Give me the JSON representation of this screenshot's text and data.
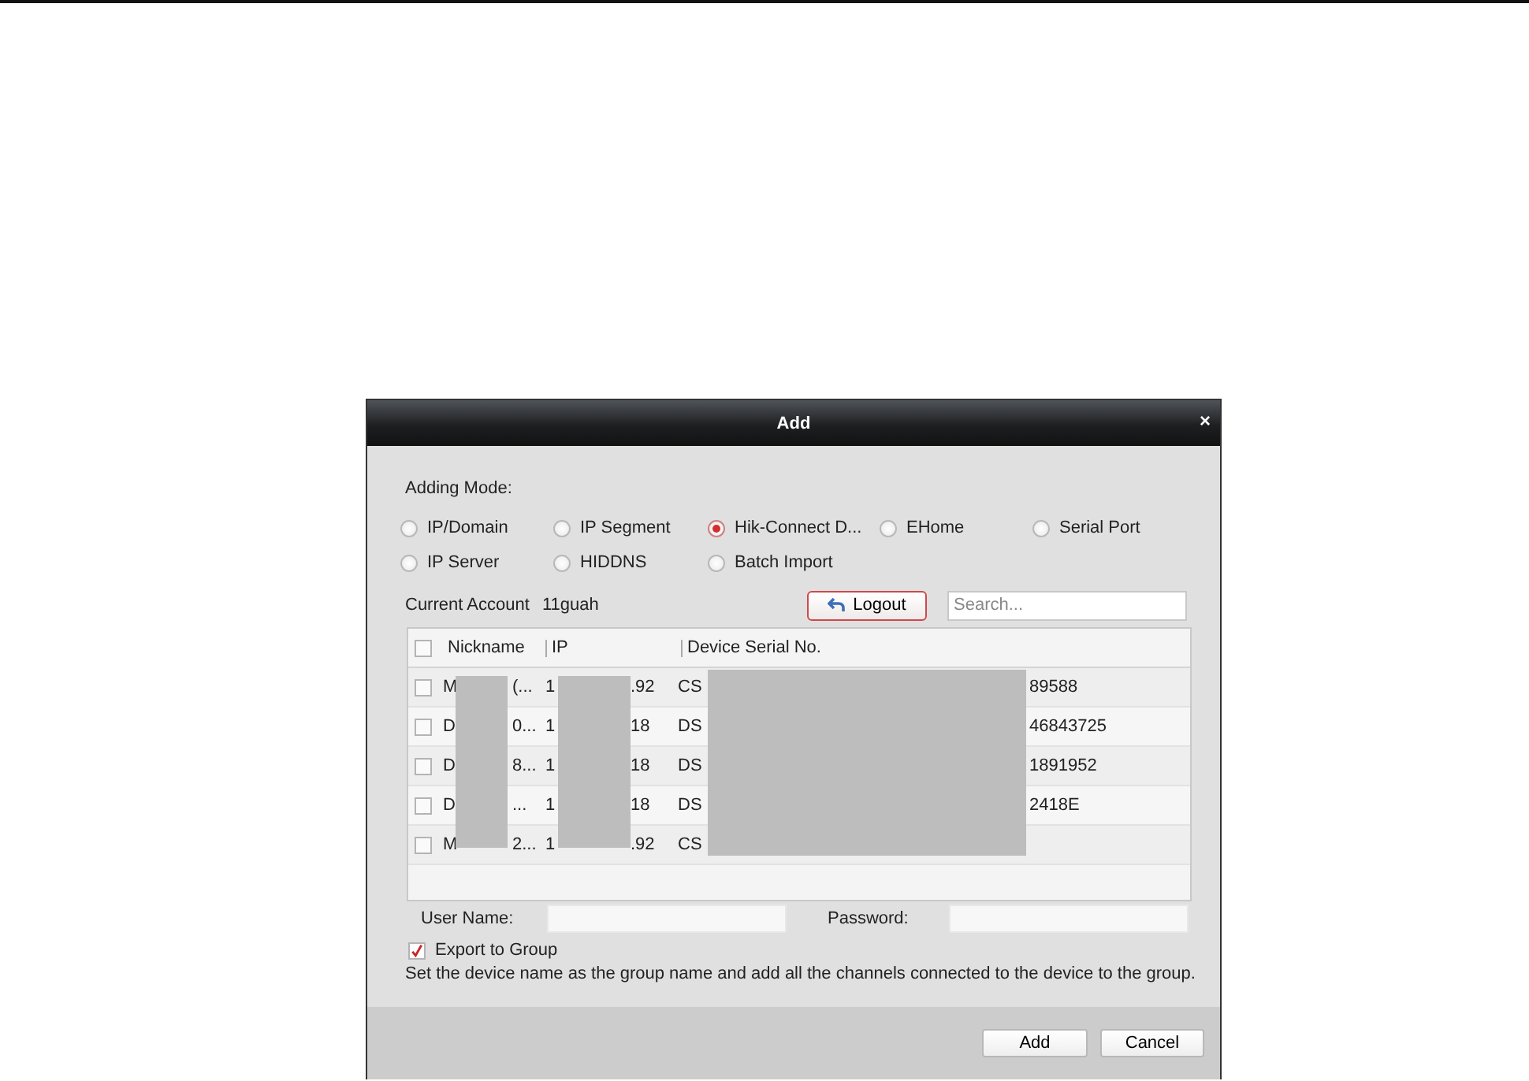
{
  "window": {
    "title": "Add",
    "close": "×"
  },
  "adding_mode": {
    "label": "Adding Mode:",
    "options": [
      {
        "label": "IP/Domain",
        "selected": false
      },
      {
        "label": "IP Segment",
        "selected": false
      },
      {
        "label": "Hik-Connect D...",
        "selected": true
      },
      {
        "label": "EHome",
        "selected": false
      },
      {
        "label": "Serial Port",
        "selected": false
      },
      {
        "label": "IP Server",
        "selected": false
      },
      {
        "label": "HIDDNS",
        "selected": false
      },
      {
        "label": "Batch Import",
        "selected": false
      }
    ]
  },
  "account": {
    "label": "Current Account",
    "value": "11guah",
    "logout": "Logout",
    "search_placeholder": "Search..."
  },
  "table": {
    "header_checked": false,
    "columns": [
      "Nickname",
      "IP",
      "Device Serial No."
    ],
    "rows": [
      {
        "checked": false,
        "nickname": [
          "M",
          "(..."
        ],
        "ip": [
          "1",
          ".92"
        ],
        "serial": [
          "CS",
          "89588"
        ]
      },
      {
        "checked": false,
        "nickname": [
          "D",
          "0..."
        ],
        "ip": [
          "1",
          "18"
        ],
        "serial": [
          "DS",
          "46843725"
        ]
      },
      {
        "checked": false,
        "nickname": [
          "D",
          "8..."
        ],
        "ip": [
          "1",
          "18"
        ],
        "serial": [
          "DS",
          "1891952"
        ]
      },
      {
        "checked": false,
        "nickname": [
          "D",
          "..."
        ],
        "ip": [
          "1",
          "18"
        ],
        "serial": [
          "DS",
          "2418E"
        ]
      },
      {
        "checked": false,
        "nickname": [
          "M",
          "2..."
        ],
        "ip": [
          "1",
          ".92"
        ],
        "serial": [
          "CS"
        ]
      }
    ]
  },
  "credentials": {
    "user_label": "User Name:",
    "password_label": "Password:"
  },
  "export": {
    "label": "Export to Group",
    "checked": true,
    "description": "Set the device name as the group name and add all the channels connected to the device to the group."
  },
  "buttons": [
    "Add",
    "Cancel"
  ]
}
